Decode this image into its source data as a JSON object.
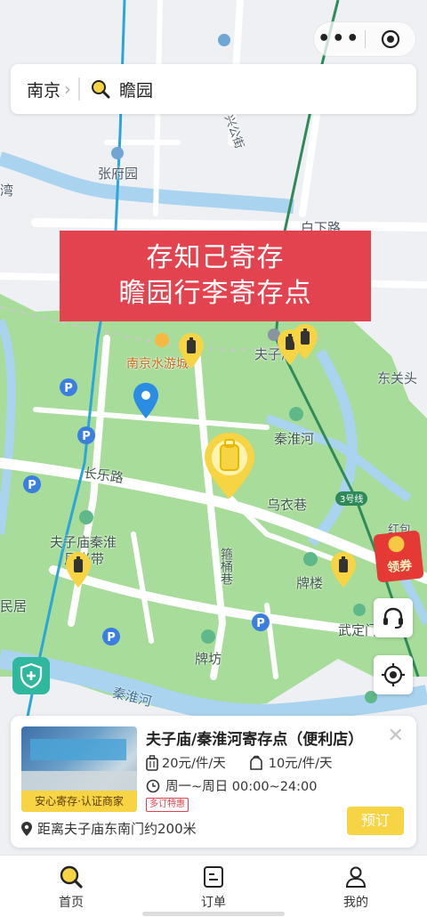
{
  "search": {
    "city": "南京",
    "query": "瞻园"
  },
  "banner": {
    "line1": "存知己寄存",
    "line2": "瞻园行李寄存点"
  },
  "map_labels": {
    "zhangfuyuan": "张府园",
    "baixialu": "白下路",
    "xingongjie": "兴公街",
    "nanjingshuiyou": "南京水游城",
    "fuzimiao": "夫子庙",
    "dongguantou": "东关头",
    "qinhuaihe_top": "秦淮河",
    "changlelu": "长乐路",
    "wuyixiang": "乌衣巷",
    "line3": "3号线",
    "fuzimiao_qinhuai": "夫子庙秦淮",
    "fengguangdai": "风光带",
    "zhongtongxiang": "箍桶巷",
    "pailou": "牌楼",
    "wudingmen": "武定门",
    "minju": "民居",
    "paifang": "牌坊",
    "qinhuaihe_bottom": "秦淮河",
    "wan": "湾",
    "hongbao": "红包"
  },
  "coupon": {
    "label": "领券"
  },
  "store": {
    "name": "夫子庙/秦淮河寄存点（便利店）",
    "badge": "安心寄存·认证商家",
    "price_large": "20元/件/天",
    "price_small": "10元/件/天",
    "hours": "周一~周日 00:00~24:00",
    "promo_tag": "多订特惠",
    "distance": "距离夫子庙东南门约200米",
    "book_label": "预订"
  },
  "tabs": [
    {
      "label": "首页"
    },
    {
      "label": "订单"
    },
    {
      "label": "我的"
    }
  ],
  "colors": {
    "accent": "#f7d444",
    "banner": "#e2434e",
    "park": "#a8dc9a",
    "water": "#a9d3ef"
  }
}
